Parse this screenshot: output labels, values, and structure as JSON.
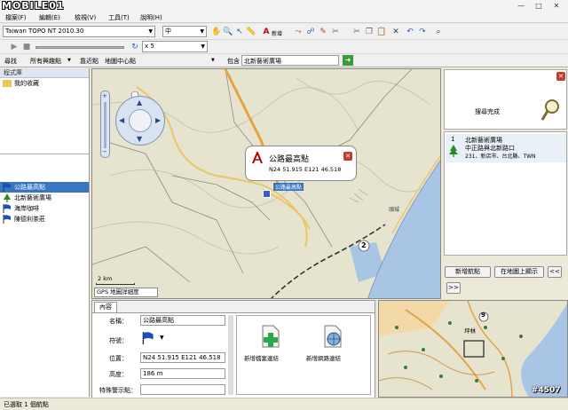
{
  "branding": {
    "logo_text": "MOBILE01",
    "watermark": "#4507"
  },
  "window": {
    "min": "—",
    "max": "□",
    "close": "✕"
  },
  "menu": [
    "檔案(F)",
    "編輯(E)",
    "檢視(V)",
    "工具(T)",
    "說明(H)"
  ],
  "toolbar": {
    "map_product": "Taiwan TOPO NT 2010.30",
    "detail_level": "中",
    "new_label": "新增",
    "speed": "x 5"
  },
  "search": {
    "find_label": "尋找",
    "category": "所有興趣點",
    "near_label": "靠近點",
    "near_value": "地圖中心點",
    "contains_label": "包含",
    "query": "北新藝術廣場"
  },
  "library": {
    "header": "程式庫",
    "root": "我的收藏",
    "places": [
      {
        "name": "公路最高點",
        "selected": true
      },
      {
        "name": "北新藝術廣場",
        "selected": false
      },
      {
        "name": "海岸咖啡",
        "selected": false
      },
      {
        "name": "陳德利茶莊",
        "selected": false
      }
    ]
  },
  "map": {
    "popup_title": "公路最高點",
    "popup_coords": "N24 51.915 E121 46.518",
    "marker_label": "公路最高點",
    "road_number": "2",
    "place_label": "頭城",
    "scale": "2 km",
    "detail_tag": "GPS 地圖詳細度"
  },
  "results": {
    "status": "搜尋完成",
    "item_index": "1",
    "item_name": "北新藝術廣場",
    "item_street": "中正路與北新路口",
    "item_address": "231、新店市、台北縣、TWN",
    "add_waypoint": "新增航點",
    "show_on_map": "在地圖上顯示",
    "prev": "<<",
    "next": ">>"
  },
  "details": {
    "tab": "內容",
    "name_label": "名稱：",
    "name_value": "公路最高點",
    "symbol_label": "符號：",
    "position_label": "位置：",
    "position_value": "N24 51.915 E121 46.518",
    "elevation_label": "高度：",
    "elevation_value": "186 m",
    "proximity_label": "特殊警示點：",
    "file_link": "新增檔案連結",
    "web_link": "新增網路連結"
  },
  "minimap": {
    "road_number": "9",
    "place": "坪林"
  },
  "statusbar": {
    "text": "已選取 1 個航點"
  }
}
